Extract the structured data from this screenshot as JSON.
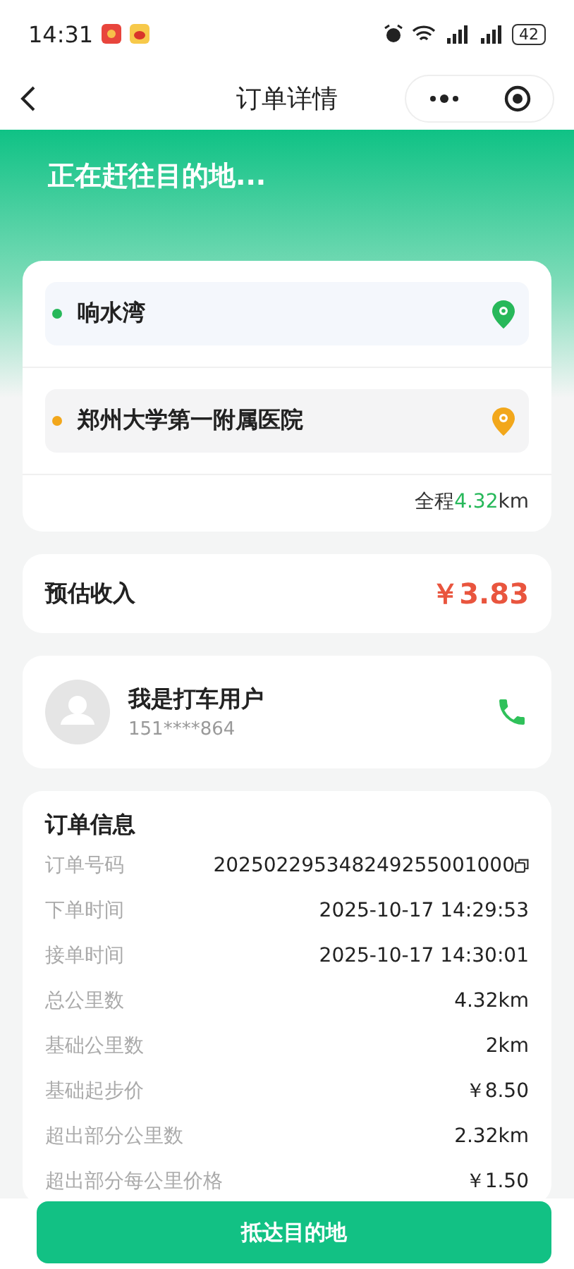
{
  "status_bar": {
    "time": "14:31",
    "battery": "42"
  },
  "nav": {
    "title": "订单详情"
  },
  "banner": {
    "status": "正在赶往目的地..."
  },
  "route": {
    "stops": [
      {
        "name": "响水湾",
        "color": "#27b85a"
      },
      {
        "name": "郑州大学第一附属医院",
        "color": "#f2a71b"
      }
    ],
    "total_label": "全程",
    "distance": "4.32",
    "unit": "km"
  },
  "income": {
    "label": "预估收入",
    "amount": "￥3.83"
  },
  "passenger": {
    "name": "我是打车用户",
    "phone": "151****864"
  },
  "order_info": {
    "title": "订单信息",
    "rows": [
      {
        "label": "订单号码",
        "value": "202502295348249255001000",
        "copyable": true
      },
      {
        "label": "下单时间",
        "value": "2025-10-17 14:29:53",
        "copyable": false
      },
      {
        "label": "接单时间",
        "value": "2025-10-17 14:30:01",
        "copyable": false
      },
      {
        "label": "总公里数",
        "value": "4.32km",
        "copyable": false
      },
      {
        "label": "基础公里数",
        "value": "2km",
        "copyable": false
      },
      {
        "label": "基础起步价",
        "value": "￥8.50",
        "copyable": false
      },
      {
        "label": "超出部分公里数",
        "value": "2.32km",
        "copyable": false
      },
      {
        "label": "超出部分每公里价格",
        "value": "￥1.50",
        "copyable": false
      }
    ]
  },
  "action_button": "抵达目的地"
}
